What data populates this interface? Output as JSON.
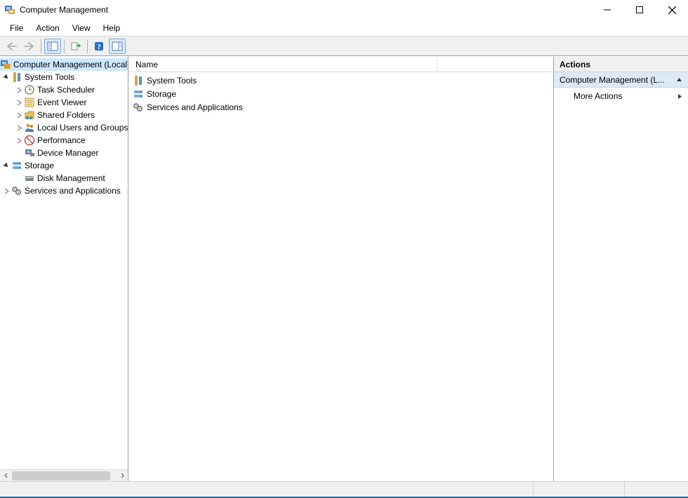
{
  "title": "Computer Management",
  "menu": {
    "file": "File",
    "action": "Action",
    "view": "View",
    "help": "Help"
  },
  "tree": {
    "root": "Computer Management (Local)",
    "system_tools": "System Tools",
    "task_scheduler": "Task Scheduler",
    "event_viewer": "Event Viewer",
    "shared_folders": "Shared Folders",
    "local_users": "Local Users and Groups",
    "performance": "Performance",
    "device_manager": "Device Manager",
    "storage": "Storage",
    "disk_management": "Disk Management",
    "services_apps": "Services and Applications"
  },
  "list": {
    "col_name": "Name",
    "items": {
      "system_tools": "System Tools",
      "storage": "Storage",
      "services_apps": "Services and Applications"
    }
  },
  "actions": {
    "header": "Actions",
    "section": "Computer Management (L...",
    "more": "More Actions"
  }
}
